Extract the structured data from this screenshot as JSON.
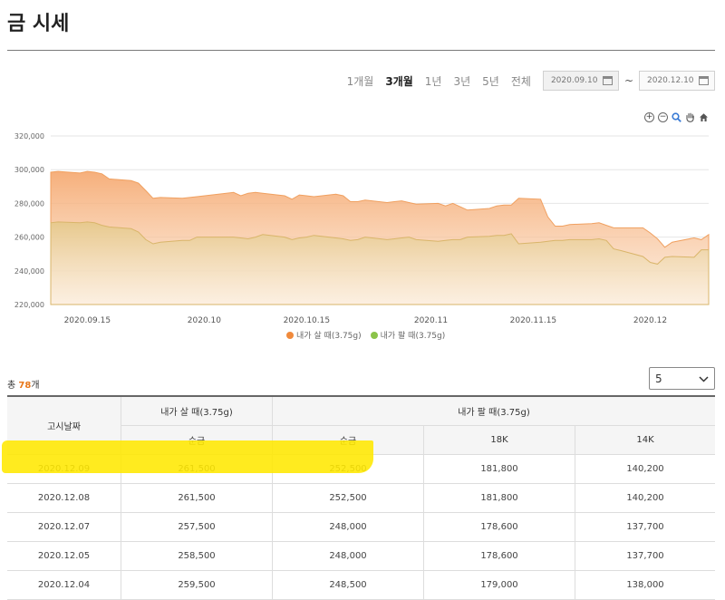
{
  "page": {
    "title": "금 시세"
  },
  "period": {
    "options": [
      "1개월",
      "3개월",
      "1년",
      "3년",
      "5년",
      "전체"
    ],
    "selected_index": 1,
    "date_from": "2020.09.10",
    "date_to": "2020.12.10",
    "separator": "~"
  },
  "chart_data": {
    "type": "area",
    "x": [
      "2020.09.10",
      "2020.09.11",
      "2020.09.14",
      "2020.09.15",
      "2020.09.16",
      "2020.09.17",
      "2020.09.18",
      "2020.09.21",
      "2020.09.22",
      "2020.09.23",
      "2020.09.24",
      "2020.09.25",
      "2020.09.28",
      "2020.09.29",
      "2020.09.30",
      "2020.10.05",
      "2020.10.06",
      "2020.10.07",
      "2020.10.08",
      "2020.10.09",
      "2020.10.12",
      "2020.10.13",
      "2020.10.14",
      "2020.10.15",
      "2020.10.16",
      "2020.10.19",
      "2020.10.20",
      "2020.10.21",
      "2020.10.22",
      "2020.10.23",
      "2020.10.26",
      "2020.10.27",
      "2020.10.28",
      "2020.10.29",
      "2020.10.30",
      "2020.11.02",
      "2020.11.03",
      "2020.11.04",
      "2020.11.05",
      "2020.11.06",
      "2020.11.09",
      "2020.11.10",
      "2020.11.11",
      "2020.11.12",
      "2020.11.13",
      "2020.11.16",
      "2020.11.17",
      "2020.11.18",
      "2020.11.19",
      "2020.11.20",
      "2020.11.23",
      "2020.11.24",
      "2020.11.25",
      "2020.11.26",
      "2020.11.27",
      "2020.11.30",
      "2020.12.01",
      "2020.12.02",
      "2020.12.03",
      "2020.12.04",
      "2020.12.07",
      "2020.12.08",
      "2020.12.09"
    ],
    "x_ticks": [
      "2020.09.15",
      "2020.10",
      "2020.10.15",
      "2020.11",
      "2020.11.15",
      "2020.12"
    ],
    "x_tick_dates": [
      "2020.09.15",
      "2020.10.01",
      "2020.10.15",
      "2020.11.01",
      "2020.11.15",
      "2020.12.01"
    ],
    "y_ticks": [
      "320,000",
      "300,000",
      "280,000",
      "260,000",
      "240,000",
      "220,000"
    ],
    "ylim": [
      220000,
      320000
    ],
    "grid": true,
    "legend_position": "bottom",
    "series": [
      {
        "name": "내가 살 때(3.75g)",
        "color": "#f08a3c",
        "values": [
          298500,
          299000,
          298000,
          299000,
          298500,
          297500,
          294500,
          293500,
          292000,
          287500,
          283000,
          283500,
          283000,
          283500,
          284000,
          286500,
          284500,
          286000,
          286500,
          286000,
          284500,
          282500,
          285000,
          284500,
          284000,
          285500,
          284500,
          281000,
          281000,
          282000,
          280500,
          281000,
          281500,
          280500,
          279500,
          280000,
          278500,
          280000,
          278000,
          276000,
          277000,
          278500,
          279000,
          279000,
          283000,
          282500,
          272000,
          266500,
          266500,
          267500,
          268000,
          268500,
          267000,
          265500,
          265500,
          265500,
          262500,
          259000,
          254000,
          257000,
          259500,
          258500,
          261500
        ]
      },
      {
        "name": "내가 팔 때(3.75g)",
        "color": "#8bc34a",
        "values": [
          268500,
          269000,
          268500,
          269000,
          268500,
          267000,
          266000,
          265000,
          263000,
          258500,
          256000,
          257000,
          258000,
          258000,
          260000,
          260000,
          259500,
          259000,
          260000,
          261500,
          260000,
          258500,
          259500,
          260000,
          261000,
          259500,
          259000,
          258000,
          258500,
          260000,
          258500,
          259000,
          259500,
          260000,
          258500,
          257500,
          258000,
          258500,
          258500,
          260000,
          260500,
          261000,
          261000,
          262000,
          256000,
          257000,
          257500,
          258000,
          258000,
          258500,
          258500,
          259000,
          258000,
          253000,
          252000,
          248500,
          245000,
          244000,
          248000,
          248500,
          248000,
          252500,
          252500
        ]
      }
    ]
  },
  "chart_tools": [
    "zoom-in-icon",
    "zoom-out-icon",
    "magnify-icon",
    "hand-pan-icon",
    "home-icon"
  ],
  "summary": {
    "prefix": "총 ",
    "count": "78",
    "suffix": "개"
  },
  "page_size": {
    "value": "5"
  },
  "table": {
    "header_date": "고시날짜",
    "header_buy": "내가 살 때(3.75g)",
    "header_sell": "내가 팔 때(3.75g)",
    "sub_buy_pure": "순금",
    "sub_sell_pure": "순금",
    "sub_18k": "18K",
    "sub_14k": "14K",
    "rows": [
      [
        "2020.12.09",
        "261,500",
        "252,500",
        "181,800",
        "140,200"
      ],
      [
        "2020.12.08",
        "261,500",
        "252,500",
        "181,800",
        "140,200"
      ],
      [
        "2020.12.07",
        "257,500",
        "248,000",
        "178,600",
        "137,700"
      ],
      [
        "2020.12.05",
        "258,500",
        "248,000",
        "178,600",
        "137,700"
      ],
      [
        "2020.12.04",
        "259,500",
        "248,500",
        "179,000",
        "138,000"
      ]
    ]
  }
}
